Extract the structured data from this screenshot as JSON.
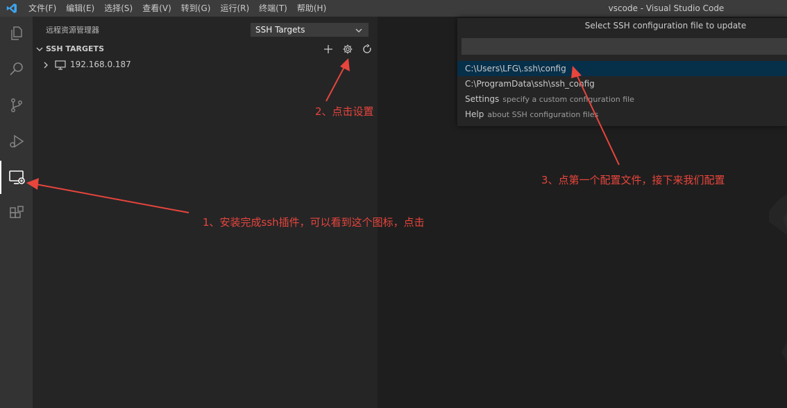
{
  "titlebar": {
    "menu": [
      "文件(F)",
      "编辑(E)",
      "选择(S)",
      "查看(V)",
      "转到(G)",
      "运行(R)",
      "终端(T)",
      "帮助(H)"
    ],
    "window_title": "vscode - Visual Studio Code"
  },
  "activitybar": {
    "items": [
      "explorer-icon",
      "search-icon",
      "source-control-icon",
      "run-debug-icon",
      "remote-explorer-icon",
      "extensions-icon"
    ],
    "active": "remote-explorer-icon"
  },
  "sidebar": {
    "title": "远程资源管理器",
    "target_select": "SSH Targets",
    "section_title": "SSH TARGETS",
    "actions": [
      "add-icon",
      "gear-icon",
      "refresh-icon"
    ],
    "hosts": [
      "192.168.0.187"
    ]
  },
  "quickpick": {
    "title": "Select SSH configuration file to update",
    "input_value": "",
    "items": [
      {
        "label": "C:\\Users\\LFG\\.ssh\\config",
        "description": "",
        "selected": true
      },
      {
        "label": "C:\\ProgramData\\ssh\\ssh_config",
        "description": ""
      },
      {
        "label": "Settings",
        "description": "specify a custom configuration file"
      },
      {
        "label": "Help",
        "description": "about SSH configuration files"
      }
    ]
  },
  "annotations": {
    "step1": "1、安装完成ssh插件，可以看到这个图标，点击",
    "step2": "2、点击设置",
    "step3": "3、点第一个配置文件，接下来我们配置"
  },
  "colors": {
    "accent": "#007acc",
    "annotation": "#e8453c",
    "selection": "#062f4a"
  }
}
